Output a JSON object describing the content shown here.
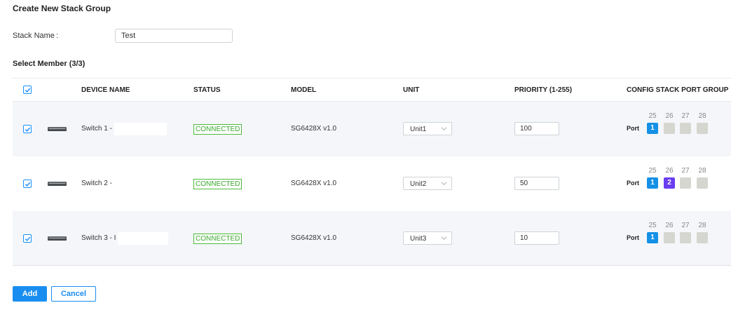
{
  "page": {
    "title": "Create New Stack Group"
  },
  "form": {
    "stack_name_label": "Stack Name :",
    "stack_name_value": "Test"
  },
  "members": {
    "title": "Select Member (3/3)",
    "columns": {
      "device_name": "DEVICE NAME",
      "status": "STATUS",
      "model": "MODEL",
      "unit": "UNIT",
      "priority": "PRIORITY (1-255)",
      "config": "CONFIG STACK PORT GROUP"
    },
    "rows": [
      {
        "checked": true,
        "device_name": "Switch 1 -",
        "status": "CONNECTED",
        "model": "SG6428X v1.0",
        "unit": "Unit1",
        "priority": "100",
        "port_label": "Port",
        "ports": [
          {
            "num": "25",
            "value": "1",
            "state": "blue"
          },
          {
            "num": "26",
            "value": "",
            "state": "empty"
          },
          {
            "num": "27",
            "value": "",
            "state": "empty"
          },
          {
            "num": "28",
            "value": "",
            "state": "empty"
          }
        ]
      },
      {
        "checked": true,
        "device_name": "Switch 2 -",
        "status": "CONNECTED",
        "model": "SG6428X v1.0",
        "unit": "Unit2",
        "priority": "50",
        "port_label": "Port",
        "ports": [
          {
            "num": "25",
            "value": "1",
            "state": "blue"
          },
          {
            "num": "26",
            "value": "2",
            "state": "purple"
          },
          {
            "num": "27",
            "value": "",
            "state": "empty"
          },
          {
            "num": "28",
            "value": "",
            "state": "empty"
          }
        ]
      },
      {
        "checked": true,
        "device_name": "Switch 3 - I",
        "status": "CONNECTED",
        "model": "SG6428X v1.0",
        "unit": "Unit3",
        "priority": "10",
        "port_label": "Port",
        "ports": [
          {
            "num": "25",
            "value": "1",
            "state": "blue"
          },
          {
            "num": "26",
            "value": "",
            "state": "empty"
          },
          {
            "num": "27",
            "value": "",
            "state": "empty"
          },
          {
            "num": "28",
            "value": "",
            "state": "empty"
          }
        ]
      }
    ]
  },
  "actions": {
    "add_label": "Add",
    "cancel_label": "Cancel"
  },
  "colors": {
    "accent": "#1a8ef0",
    "connected": "#4cbb3a",
    "port_purple": "#6a3df0",
    "port_empty": "#d5d6cf"
  },
  "icons": {
    "checkbox": "check-icon",
    "device": "switch-device-icon",
    "dropdown": "chevron-down-icon"
  }
}
